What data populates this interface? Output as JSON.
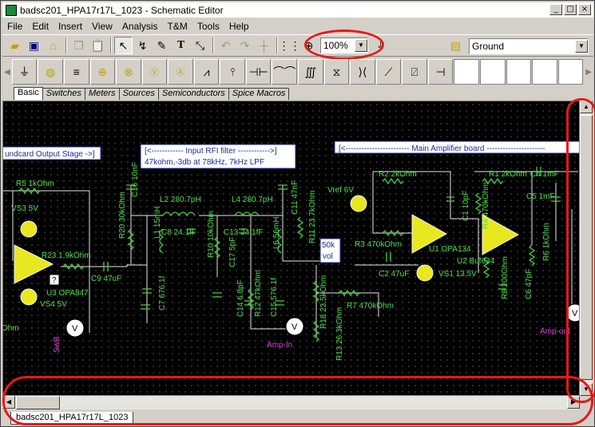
{
  "title": "badsc201_HPA17r17L_1023 - Schematic Editor",
  "window_buttons": [
    "_",
    "□",
    "×"
  ],
  "menu": [
    "File",
    "Edit",
    "Insert",
    "View",
    "Analysis",
    "T&M",
    "Tools",
    "Help"
  ],
  "zoom_value": "100%",
  "component_select": "Ground",
  "palette_tabs": [
    "Basic",
    "Switches",
    "Meters",
    "Sources",
    "Semiconductors",
    "Spice Macros"
  ],
  "sheet_tab": "badsc201_HPA17r17L_1023",
  "schematic": {
    "headers": [
      "undcard Output Stage ->]",
      "[<------------ Input RFI filter ------------>]",
      "47kohm,-3db at 78kHz, 7kHz LPF",
      "[<------------------------ Main Amplifier board ----------------------"
    ],
    "labels": [
      "R5 1kOhm",
      "VS3 5V",
      "R23 1.9kOhm",
      "C9 47uF",
      "U3 OPA847",
      "VS4 5V",
      "Ohm",
      "SwB",
      "C16 10nF",
      "R20 30kOhm",
      "L2 280.7pH",
      "L1 15mH",
      "C8 24.1fF",
      "R10 10kOhm",
      "C17 5pF",
      "L4 280.7pH",
      "C13 24.1fF",
      "C11 47nF",
      "L6 56mH",
      "R11 23.7kOhm",
      "C7 676.1f",
      "C14 6.8pF",
      "R12 47kOhm",
      "C15 576.1f",
      "50k",
      "vol",
      "R18 23.5kOhm",
      "R13 26.3kOhm",
      "R7 470kOhm",
      "Amp-In",
      "R2 2kOhm",
      "Vref 6V",
      "R3 470kOhm",
      "C2 47uF",
      "U1 OPA134",
      "VS1 13.5V",
      "C1 10pF",
      "R1 2kOhm",
      "C4 1mF",
      "R4 470kOhm",
      "C5 1mF",
      "U2 Buf634",
      "R8 200Ohm",
      "C6 47pF",
      "R6 1kOhm",
      "Amp-out",
      "V",
      "?"
    ]
  }
}
